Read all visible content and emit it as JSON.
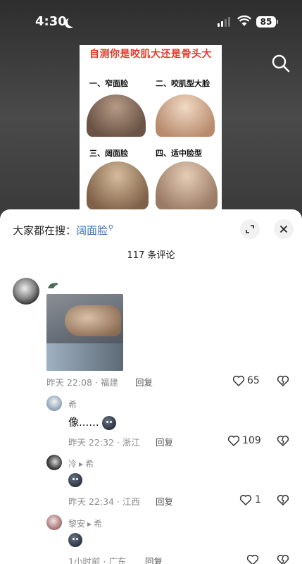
{
  "status_bar": {
    "time": "4:30",
    "battery": "85"
  },
  "video": {
    "infographic": {
      "title": "自测你是咬肌大还是骨头大",
      "labels": [
        "一、窄面脸",
        "二、咬肌型大脸",
        "三、阔面脸",
        "四、适中脸型"
      ]
    }
  },
  "sheet": {
    "search_prefix": "大家都在搜：",
    "search_keyword": "阔面脸",
    "comment_count": "117 条评论"
  },
  "comments": [
    {
      "time": "昨天 22:08",
      "location": "福建",
      "reply_label": "回复",
      "likes": "65"
    },
    {
      "username": "希",
      "text": "像......",
      "time": "昨天 22:32",
      "location": "浙江",
      "reply_label": "回复",
      "likes": "109"
    },
    {
      "username": "冷",
      "reply_to": "希",
      "time": "昨天 22:34",
      "location": "江西",
      "reply_label": "回复",
      "likes": "1"
    },
    {
      "username": "黎安",
      "reply_to": "希",
      "time": "1小时前",
      "location": "广东",
      "reply_label": "回复",
      "likes": ""
    }
  ],
  "colors": {
    "keyword": "#3b6fb6",
    "title_red": "#e03b2c"
  }
}
